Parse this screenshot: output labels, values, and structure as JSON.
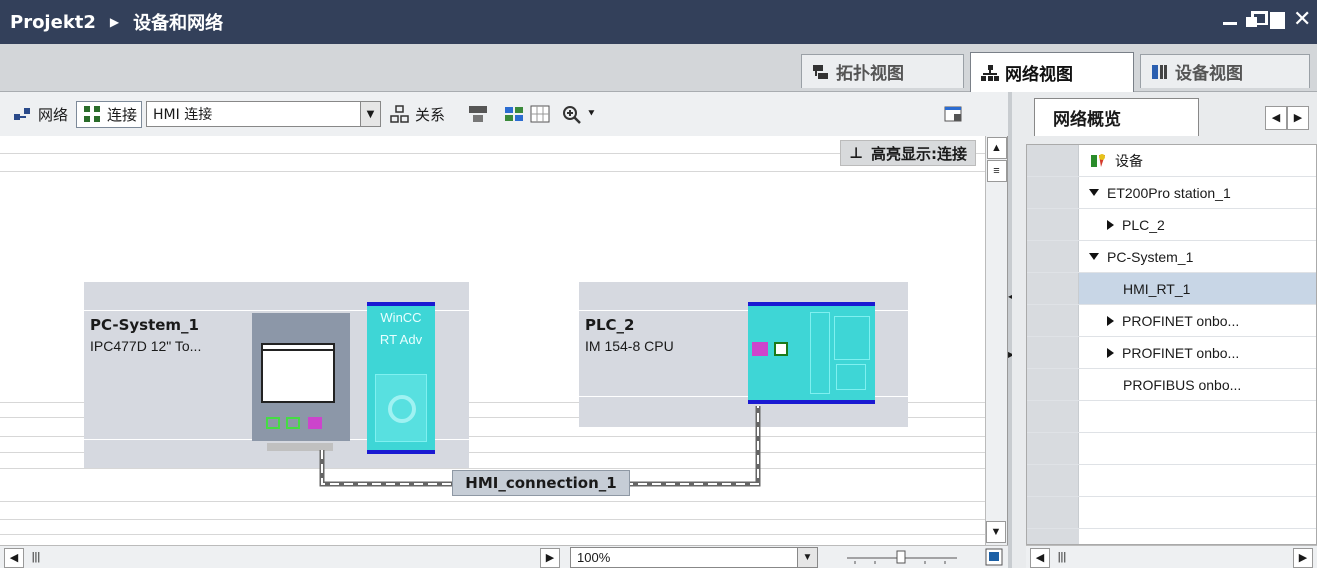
{
  "title": {
    "project": "Projekt2",
    "page": "设备和网络"
  },
  "view_tabs": [
    {
      "label": "拓扑视图",
      "active": false
    },
    {
      "label": "网络视图",
      "active": true
    },
    {
      "label": "设备视图",
      "active": false
    }
  ],
  "toolbar": {
    "network_label": "网络",
    "connect_label": "连接",
    "connection_type": "HMI 连接",
    "relations_label": "关系"
  },
  "canvas": {
    "highlight_label": "高亮显示:连接",
    "connection_label": "HMI_connection_1"
  },
  "devices": [
    {
      "name": "PC-System_1",
      "type": "IPC477D 12\" To...",
      "runtime_line1": "WinCC",
      "runtime_line2": "RT Adv"
    },
    {
      "name": "PLC_2",
      "type": "IM 154-8 CPU"
    }
  ],
  "zoom": {
    "value": "100%"
  },
  "overview": {
    "tab_label": "网络概览",
    "header": "设备",
    "rows": [
      {
        "label": "ET200Pro station_1",
        "expander": "expanded",
        "indent": 1
      },
      {
        "label": "PLC_2",
        "expander": "collapsed",
        "indent": 2
      },
      {
        "label": "PC-System_1",
        "expander": "expanded",
        "indent": 1
      },
      {
        "label": "HMI_RT_1",
        "expander": "none",
        "indent": 2,
        "selected": true
      },
      {
        "label": "PROFINET onbo...",
        "expander": "collapsed",
        "indent": 2
      },
      {
        "label": "PROFINET onbo...",
        "expander": "collapsed",
        "indent": 2
      },
      {
        "label": "PROFIBUS onbo...",
        "expander": "none",
        "indent": 2
      }
    ]
  },
  "colors": {
    "titlebar": "#33405a",
    "device_bg": "#d6d9e0",
    "cyan": "#3ed6d6",
    "blue_bar": "#1a1ad2",
    "magenta": "#cc44cc",
    "green": "#44dd44"
  }
}
